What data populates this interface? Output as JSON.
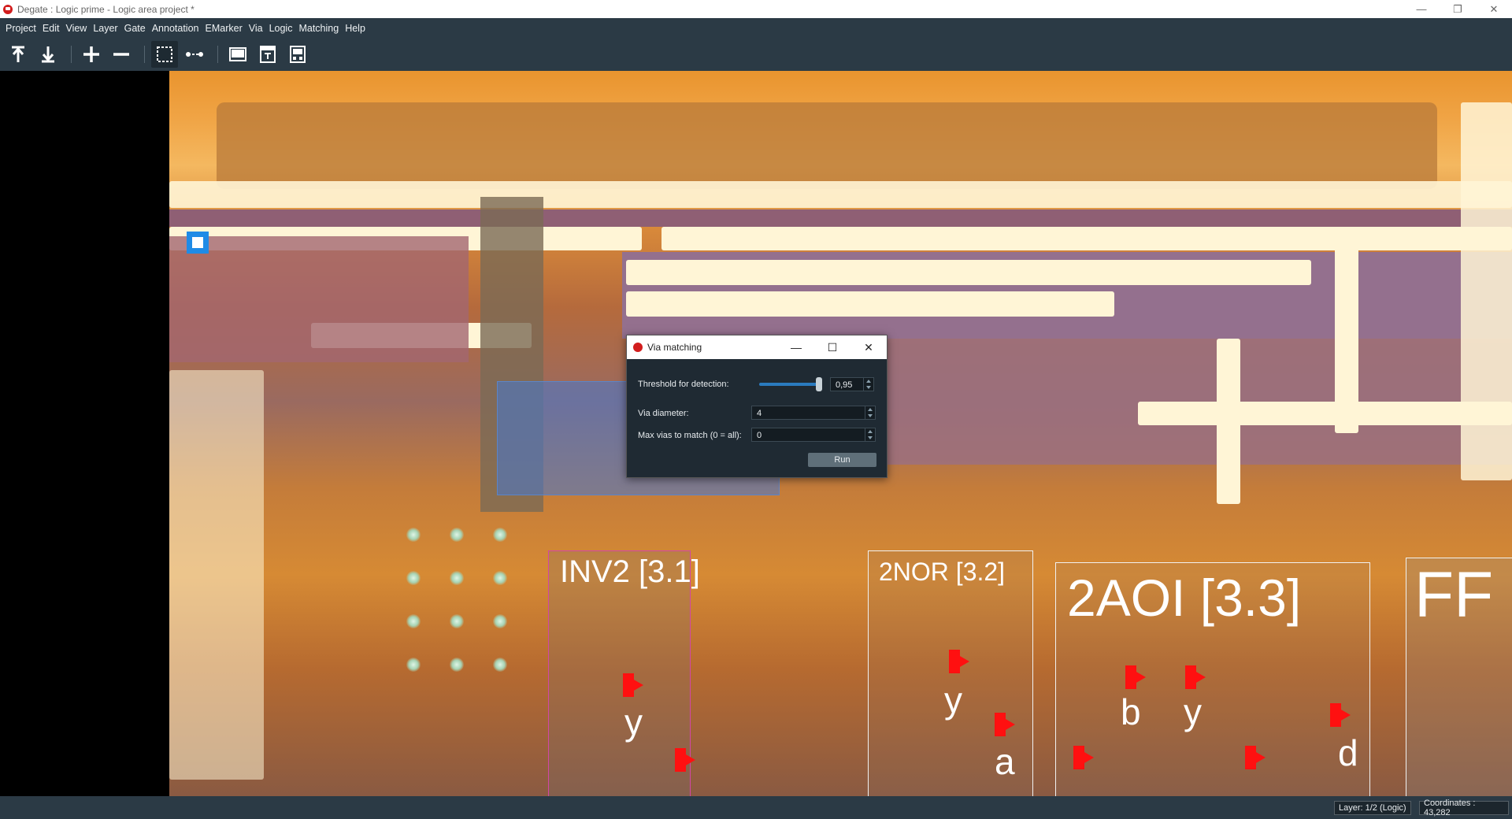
{
  "window": {
    "title": "Degate : Logic prime - Logic area project *",
    "controls": [
      "—",
      "❐",
      "✕"
    ]
  },
  "menu": [
    "Project",
    "Edit",
    "View",
    "Layer",
    "Gate",
    "Annotation",
    "EMarker",
    "Via",
    "Logic",
    "Matching",
    "Help"
  ],
  "toolbar": {
    "icons": [
      "layer-up-icon",
      "layer-down-icon",
      "zoom-in-icon",
      "zoom-out-icon",
      "area-select-icon",
      "wire-tool-icon",
      "view-image-icon",
      "view-template-icon",
      "view-layout-icon"
    ]
  },
  "canvas": {
    "gates": [
      {
        "name": "INV2 [3.1]",
        "ports": [
          "y"
        ]
      },
      {
        "name": "2NOR [3.2]",
        "ports": [
          "y",
          "a"
        ]
      },
      {
        "name": "2AOI [3.3]",
        "ports": [
          "b",
          "y",
          "d"
        ]
      },
      {
        "name": "FF"
      }
    ]
  },
  "dialog": {
    "title": "Via matching",
    "controls": [
      "—",
      "☐",
      "✕"
    ],
    "threshold_label": "Threshold for detection:",
    "threshold_value": "0,95",
    "threshold_fraction": 0.95,
    "via_diameter_label": "Via diameter:",
    "via_diameter_value": "4",
    "max_vias_label": "Max vias to match (0 = all):",
    "max_vias_value": "0",
    "run_label": "Run"
  },
  "status": {
    "layer": "Layer: 1/2 (Logic)",
    "coordinates": "Coordinates : 43,282"
  }
}
